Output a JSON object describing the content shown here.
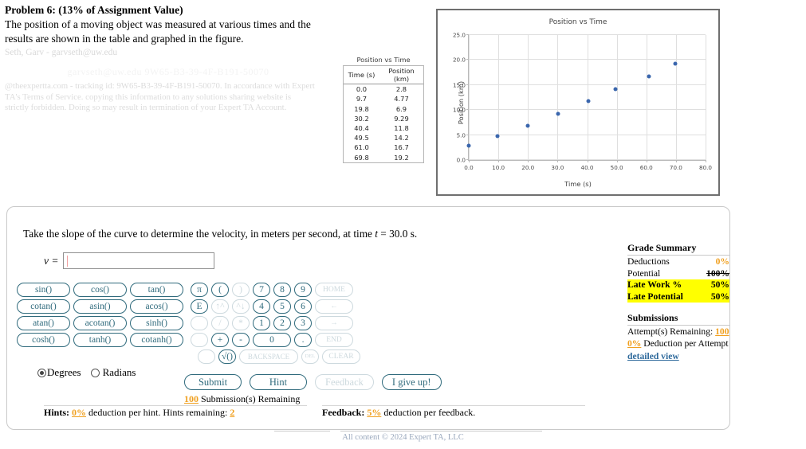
{
  "problem": {
    "title": "Problem 6: (13% of Assignment Value)",
    "statement_line1": " The position of a moving object was measured at various times and the",
    "statement_line2": "results are shown in the table and graphed in the figure.",
    "watermark_name": "Seth, Garv - garvseth@uw.edu",
    "watermark_faint": "garvseth@uw.edu 9W65-B3-39-4F-B191-50070",
    "watermark_terms_line1": "@theexpertta.com - tracking id: 9W65-B3-39-4F-B191-50070. In accordance with Expert",
    "watermark_terms_line2": "TA's Terms of Service. copying this information to any solutions sharing website is",
    "watermark_terms_line3": "strictly forbidden. Doing so may result in termination of your Expert TA Account."
  },
  "data_table": {
    "caption": "Position vs Time",
    "headers": [
      "Time (s)",
      "Position (km)"
    ],
    "rows": [
      [
        "0.0",
        "2.8"
      ],
      [
        "9.7",
        "4.77"
      ],
      [
        "19.8",
        "6.9"
      ],
      [
        "30.2",
        "9.29"
      ],
      [
        "40.4",
        "11.8"
      ],
      [
        "49.5",
        "14.2"
      ],
      [
        "61.0",
        "16.7"
      ],
      [
        "69.8",
        "19.2"
      ]
    ]
  },
  "chart_data": {
    "type": "scatter",
    "title": "Position vs Time",
    "xlabel": "Time (s)",
    "ylabel": "Position (km)",
    "x": [
      0.0,
      9.7,
      19.8,
      30.2,
      40.4,
      49.5,
      61.0,
      69.8
    ],
    "y": [
      2.8,
      4.77,
      6.9,
      9.29,
      11.8,
      14.2,
      16.7,
      19.2
    ],
    "xlim": [
      0,
      80
    ],
    "ylim": [
      0,
      25
    ],
    "xticks": [
      "0.0",
      "10.0",
      "20.0",
      "30.0",
      "40.0",
      "50.0",
      "60.0",
      "70.0",
      "80.0"
    ],
    "yticks": [
      "0.0",
      "5.0",
      "10.0",
      "15.0",
      "20.0",
      "25.0"
    ],
    "grid": true,
    "legend": "none",
    "marker_color": "#3a66ad"
  },
  "question": {
    "text_before": "Take the slope of the curve to determine the velocity, in meters per second, at time ",
    "var_italic": "t",
    "text_after": " = 30.0 s.",
    "answer_label": "v =",
    "answer_value": "",
    "answer_placeholder": ""
  },
  "keypad": {
    "rows": [
      [
        {
          "label": "sin()",
          "cls": "fn",
          "dim": false
        },
        {
          "label": "cos()",
          "cls": "fn",
          "dim": false
        },
        {
          "label": "tan()",
          "cls": "fn",
          "dim": false
        },
        {
          "label": "π",
          "cls": "sq gap",
          "dim": false
        },
        {
          "label": "(",
          "cls": "sq",
          "dim": false
        },
        {
          "label": ")",
          "cls": "sq",
          "dim": true
        },
        {
          "label": "7",
          "cls": "num",
          "dim": false
        },
        {
          "label": "8",
          "cls": "num",
          "dim": false
        },
        {
          "label": "9",
          "cls": "num",
          "dim": false
        },
        {
          "label": "HOME",
          "cls": "nav",
          "dim": true
        }
      ],
      [
        {
          "label": "cotan()",
          "cls": "fn",
          "dim": false
        },
        {
          "label": "asin()",
          "cls": "fn",
          "dim": false
        },
        {
          "label": "acos()",
          "cls": "fn",
          "dim": false
        },
        {
          "label": "E",
          "cls": "sq gap",
          "dim": false
        },
        {
          "label": "↑^",
          "cls": "sq",
          "dim": true
        },
        {
          "label": "^↓",
          "cls": "sq",
          "dim": true
        },
        {
          "label": "4",
          "cls": "num",
          "dim": false
        },
        {
          "label": "5",
          "cls": "num",
          "dim": false
        },
        {
          "label": "6",
          "cls": "num",
          "dim": false
        },
        {
          "label": "←",
          "cls": "nav",
          "dim": true
        }
      ],
      [
        {
          "label": "atan()",
          "cls": "fn",
          "dim": false
        },
        {
          "label": "acotan()",
          "cls": "fn",
          "dim": false
        },
        {
          "label": "sinh()",
          "cls": "fn",
          "dim": false
        },
        {
          "label": "",
          "cls": "sq gap blank",
          "dim": true
        },
        {
          "label": "/",
          "cls": "sq",
          "dim": true
        },
        {
          "label": "*",
          "cls": "sq",
          "dim": true
        },
        {
          "label": "1",
          "cls": "num",
          "dim": false
        },
        {
          "label": "2",
          "cls": "num",
          "dim": false
        },
        {
          "label": "3",
          "cls": "num",
          "dim": false
        },
        {
          "label": "→",
          "cls": "nav",
          "dim": true
        }
      ],
      [
        {
          "label": "cosh()",
          "cls": "fn",
          "dim": false
        },
        {
          "label": "tanh()",
          "cls": "fn",
          "dim": false
        },
        {
          "label": "cotanh()",
          "cls": "fn",
          "dim": false
        },
        {
          "label": "",
          "cls": "sq gap blank",
          "dim": true
        },
        {
          "label": "+",
          "cls": "sq",
          "dim": false
        },
        {
          "label": "-",
          "cls": "sq",
          "dim": false
        },
        {
          "label": "0",
          "cls": "wide0",
          "dim": false
        },
        {
          "label": ".",
          "cls": "sq",
          "dim": false
        },
        {
          "label": "END",
          "cls": "nav",
          "dim": true
        }
      ],
      [
        {
          "label": "",
          "cls": "sq gap blank",
          "dim": true
        },
        {
          "label": "√()",
          "cls": "sq",
          "dim": false
        },
        {
          "label": "BACKSPACE",
          "cls": "bksp",
          "dim": true
        },
        {
          "label": "DEL",
          "cls": "del",
          "dim": true
        },
        {
          "label": "CLEAR",
          "cls": "nav",
          "dim": true
        }
      ]
    ],
    "angle_mode": {
      "degrees_label": "Degrees",
      "radians_label": "Radians",
      "selected": "Degrees"
    }
  },
  "actions": {
    "submit": "Submit",
    "hint": "Hint",
    "feedback": "Feedback",
    "give_up": "I give up!",
    "submissions_count": "100",
    "submissions_text": "Submission(s) Remaining"
  },
  "hints_row": {
    "label": "Hints:",
    "percent": "0%",
    "text_mid": " deduction per hint. Hints remaining: ",
    "remaining": "2"
  },
  "feedback_row": {
    "label": "Feedback:",
    "percent": "5%",
    "text_mid": " deduction per feedback."
  },
  "grade_summary": {
    "title": "Grade Summary",
    "rows": [
      {
        "label": "Deductions",
        "value": "0%",
        "style": "orange"
      },
      {
        "label": "Potential",
        "value": "100%",
        "style": "strike"
      },
      {
        "label": "Late Work %",
        "value": "50%",
        "style": "highlight"
      },
      {
        "label": "Late Potential",
        "value": "50%",
        "style": "highlight"
      }
    ],
    "submissions_title": "Submissions",
    "attempts_label": "Attempt(s) Remaining: ",
    "attempts_value": "100",
    "deduction_value": "0%",
    "deduction_label": " Deduction per Attempt",
    "detailed_view": "detailed view"
  },
  "footer": {
    "text": "All content © 2024 Expert TA, LLC"
  }
}
